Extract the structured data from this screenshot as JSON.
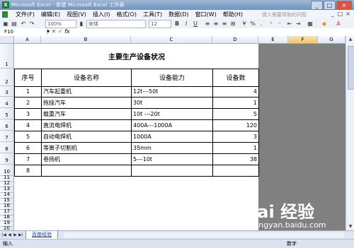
{
  "window": {
    "title": "Microsoft Excel - 新建 Microsoft Excel 工作表",
    "controls": [
      "_",
      "□",
      "×"
    ]
  },
  "menubar": {
    "items": [
      "文件(F)",
      "编辑(E)",
      "视图(V)",
      "插入(I)",
      "格式(O)",
      "工具(T)",
      "数据(D)",
      "窗口(W)",
      "帮助(H)"
    ],
    "help_placeholder": "键入需要帮助的问题"
  },
  "toolbar": {
    "zoom": "100%",
    "font_name": "宋体",
    "font_size": "12",
    "bold": "B",
    "italic": "I",
    "underline": "U"
  },
  "formula_bar": {
    "name_box": "F10",
    "fx": "fx"
  },
  "columns": [
    "A",
    "B",
    "C",
    "D",
    "E",
    "F",
    "G"
  ],
  "selected_column": "F",
  "rows": [
    "1",
    "2",
    "3",
    "4",
    "5",
    "6",
    "7",
    "8",
    "9",
    "10",
    "11",
    "12",
    "13",
    "14",
    "15",
    "16",
    "17",
    "18",
    "19",
    "20",
    "21",
    "22",
    "23",
    "24",
    "25"
  ],
  "sheet": {
    "title": "主要生产设备状况",
    "headers": [
      "序号",
      "设备名称",
      "设备能力",
      "设备数"
    ],
    "rows": [
      [
        "1",
        "汽车起重机",
        "12t---50t",
        "4"
      ],
      [
        "2",
        "拖挂汽车",
        "30t",
        "1"
      ],
      [
        "3",
        "载重汽车",
        "10t ---20t",
        "5"
      ],
      [
        "4",
        "直流电焊机",
        "400A---1000A",
        "120"
      ],
      [
        "5",
        "自动电焊机",
        "1000A",
        "3"
      ],
      [
        "6",
        "等离子切割机",
        "35mm",
        "1"
      ],
      [
        "7",
        "卷扬机",
        "5---10t",
        "38"
      ],
      [
        "8",
        "",
        "",
        ""
      ]
    ]
  },
  "tabs": {
    "active": "百度经验"
  },
  "status": {
    "mode": "输入",
    "num": "数字"
  },
  "watermark": {
    "logo": "Bai  经验",
    "url": "jingyan.baidu.com"
  },
  "colors": {
    "titlebar": "#6f92bd",
    "grid_background": "#808080",
    "selected_header": "#f4c567",
    "sheet_tab_text": "#1a3a8a"
  }
}
